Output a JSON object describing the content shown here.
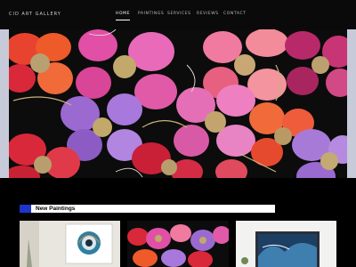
{
  "site": {
    "brand": "CID ART GALLERY"
  },
  "nav": {
    "items": [
      {
        "label": "HOME",
        "active": true
      },
      {
        "label": "PAINTINGS",
        "active": false
      },
      {
        "label": "SERVICES",
        "active": false
      },
      {
        "label": "REVIEWS",
        "active": false
      },
      {
        "label": "CONTACT",
        "active": false
      }
    ]
  },
  "hero": {
    "image": "abstract floral painting with pink, red, purple and orange flowers with gold centers on black background",
    "colors": {
      "pink": "#e05aa8",
      "red": "#d8283a",
      "purple": "#9a6ad0",
      "orange": "#ee5a2a",
      "gold": "#c2a86a",
      "black": "#0c0c0c"
    }
  },
  "section": {
    "title": "New Paintings",
    "marker_color": "#1f35c9"
  },
  "cards": [
    {
      "image": "framed abstract painting in a living room"
    },
    {
      "image": "floral painting close-up"
    },
    {
      "image": "framed blue abstract painting"
    }
  ]
}
